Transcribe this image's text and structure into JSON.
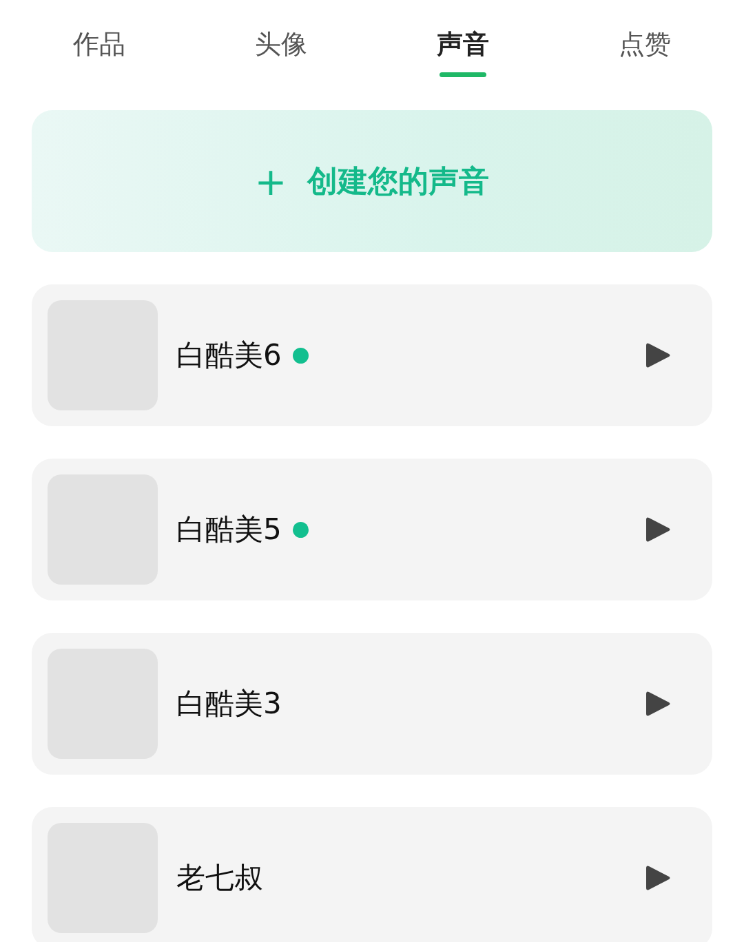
{
  "tabs": [
    {
      "label": "作品",
      "selected": false
    },
    {
      "label": "头像",
      "selected": false
    },
    {
      "label": "声音",
      "selected": true
    },
    {
      "label": "点赞",
      "selected": false
    }
  ],
  "create_button": {
    "icon": "+",
    "label": "创建您的声音"
  },
  "voices": [
    {
      "name": "白酷美6",
      "new": true
    },
    {
      "name": "白酷美5",
      "new": true
    },
    {
      "name": "白酷美3",
      "new": false
    },
    {
      "name": "老七叔",
      "new": false
    }
  ]
}
